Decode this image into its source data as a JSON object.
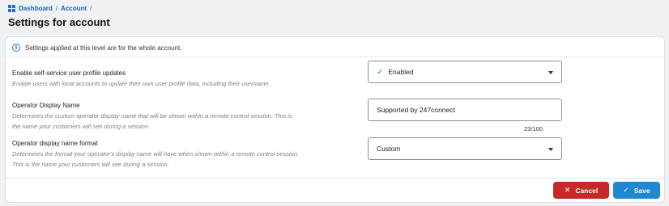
{
  "breadcrumb": {
    "items": [
      "Dashboard",
      "Account"
    ],
    "separator": "/"
  },
  "page": {
    "title": "Settings for account"
  },
  "info": {
    "text": "Settings applied at this level are for the whole account.",
    "icon": "info-icon"
  },
  "settings": {
    "self_service": {
      "label": "Enable self-service user profile updates",
      "description": "Enable users with local accounts to update their own user profile data, including their username.",
      "value": "Enabled"
    },
    "display_name": {
      "label": "Operator Display Name",
      "description_line1": "Determines the custom operator display name that will be shown within a remote control session. This is",
      "description_line2": "the name your customers will see during a session.",
      "value": "Supported by 247connect",
      "counter": "23/100"
    },
    "name_format": {
      "label": "Operator display name format",
      "description_line1": "Determines the format your operator's display name will have when shown within a remote control session.",
      "description_line2": "This is the name your customers will see during a session.",
      "value": "Custom"
    }
  },
  "actions": {
    "cancel": "Cancel",
    "save": "Save"
  },
  "colors": {
    "accent": "#1e88d0",
    "danger": "#c62828",
    "success": "#2e9e4c"
  }
}
